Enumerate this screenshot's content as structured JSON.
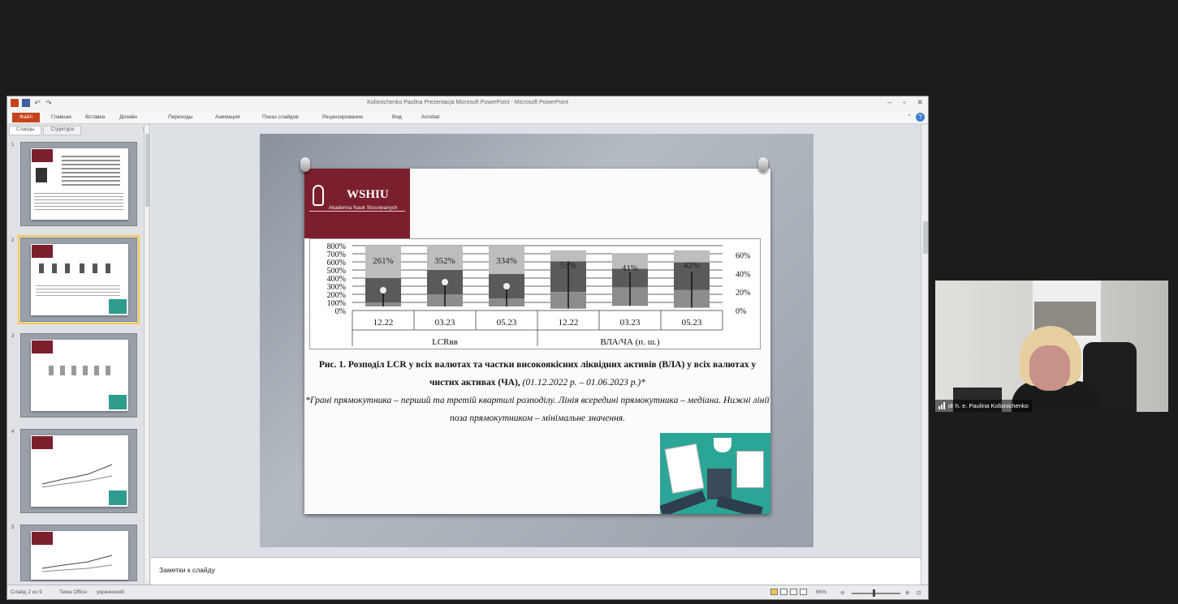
{
  "window": {
    "title": "Kolisnichenko Paulina Prezentacja Microsoft PowerPoint - Microsoft PowerPoint",
    "file_tab": "Файл",
    "tabs": [
      "Главная",
      "Вставка",
      "Дизайн",
      "Переходы",
      "Анимация",
      "Показ слайдов",
      "Рецензирование",
      "Вид",
      "Acrobat"
    ]
  },
  "thumbpane": {
    "tabs": [
      "Слайды",
      "Структура"
    ],
    "slide_numbers": [
      "1",
      "2",
      "3",
      "4",
      "5"
    ]
  },
  "slide": {
    "logo_name": "WSHIU",
    "logo_subtitle": "Akademia Nauk Stosowanych",
    "caption_bold": "Рис. 1. Розподіл LCR у всіх валютах та частки високоякісних ліквідних активів (ВЛА) у всіх валютах у чистих активах (ЧА),",
    "caption_period": "(01.12.2022 р. – 01.06.2023 р.)*",
    "caption_note": "*Грані прямокутника – перший та третій квартилі розподілу. Лінія всередині прямокутника – медіана. Нижні лінії поза прямокутником – мінімальне значення."
  },
  "chart_data": {
    "type": "box",
    "left_axis": {
      "ticks": [
        "800%",
        "700%",
        "600%",
        "500%",
        "400%",
        "300%",
        "200%",
        "100%",
        "0%"
      ],
      "ylim": [
        0,
        800
      ]
    },
    "right_axis": {
      "ticks": [
        "60%",
        "40%",
        "20%",
        "0%"
      ],
      "ylim": [
        0,
        70
      ]
    },
    "groups": [
      {
        "label": "LCRвв",
        "categories": [
          "12.22",
          "03.23",
          "05.23"
        ],
        "axis": "left",
        "boxes": [
          {
            "min": 50,
            "q1": 100,
            "median": 250,
            "q3": 400,
            "max": 800,
            "label": "261%"
          },
          {
            "min": 50,
            "q1": 200,
            "median": 350,
            "q3": 500,
            "max": 800,
            "label": "352%"
          },
          {
            "min": 50,
            "q1": 150,
            "median": 300,
            "q3": 450,
            "max": 800,
            "label": "334%"
          }
        ]
      },
      {
        "label": "ВЛА/ЧА (п. ш.)",
        "categories": [
          "12.22",
          "03.23",
          "05.23"
        ],
        "axis": "right",
        "boxes": [
          {
            "min": 2,
            "q1": 20,
            "median": 53,
            "q3": 53,
            "max": 65,
            "label": "53%"
          },
          {
            "min": 5,
            "q1": 25,
            "median": 41,
            "q3": 45,
            "max": 62,
            "label": "41%"
          },
          {
            "min": 3,
            "q1": 22,
            "median": 42,
            "q3": 52,
            "max": 65,
            "label": "42%"
          }
        ]
      }
    ]
  },
  "notes": {
    "placeholder": "Заметки к слайду"
  },
  "statusbar": {
    "slide_info": "Слайд 2 из 9",
    "theme": "Тема Office",
    "language": "украинский",
    "zoom": "66%"
  },
  "video": {
    "participant": "dr h. e. Paulina Kolisnichenko"
  },
  "colors": {
    "accent_red": "#7b1f2e",
    "file_tab": "#c4441c",
    "teal": "#2aa596",
    "selection": "#f3c84b"
  }
}
